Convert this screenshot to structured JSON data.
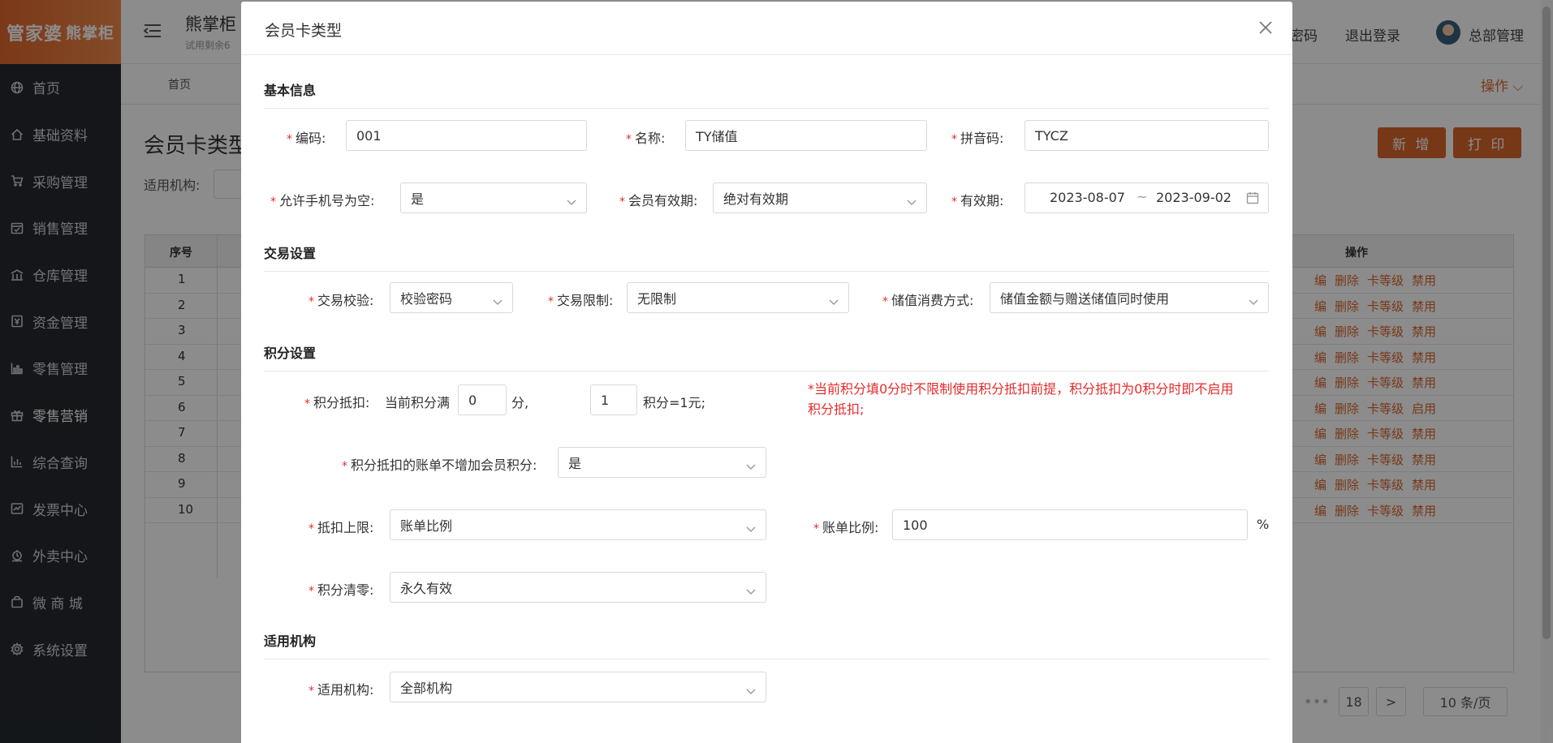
{
  "sidebar": {
    "logo_main": "管家婆",
    "logo_sub": "熊掌柜",
    "items": [
      {
        "label": "首页",
        "icon": "globe-icon"
      },
      {
        "label": "基础资料",
        "icon": "home-icon"
      },
      {
        "label": "采购管理",
        "icon": "cart-icon"
      },
      {
        "label": "销售管理",
        "icon": "calendar-icon"
      },
      {
        "label": "仓库管理",
        "icon": "warehouse-icon"
      },
      {
        "label": "资金管理",
        "icon": "money-icon"
      },
      {
        "label": "零售管理",
        "icon": "chart-icon"
      },
      {
        "label": "零售营销",
        "icon": "gift-icon"
      },
      {
        "label": "综合查询",
        "icon": "bar-chart-icon"
      },
      {
        "label": "发票中心",
        "icon": "invoice-icon"
      },
      {
        "label": "外卖中心",
        "icon": "alarm-icon"
      },
      {
        "label": "微 商 城",
        "icon": "bag-icon"
      },
      {
        "label": "系统设置",
        "icon": "gear-icon"
      }
    ]
  },
  "header": {
    "title": "熊掌柜",
    "subtitle": "试用剩余6",
    "change_password": "密码",
    "logout": "退出登录",
    "user": "总部管理"
  },
  "tabs": {
    "home": "首页",
    "ops": "操作"
  },
  "page": {
    "title": "会员卡类型",
    "filter_label": "适用机构:",
    "add_button": "新 增",
    "print_button": "打 印"
  },
  "table": {
    "col_index": "序号",
    "col_ops": "操作",
    "rows": [
      {
        "idx": "1",
        "ops": [
          "编",
          "删除",
          "卡等级",
          "禁用"
        ]
      },
      {
        "idx": "2",
        "ops": [
          "编",
          "删除",
          "卡等级",
          "禁用"
        ]
      },
      {
        "idx": "3",
        "ops": [
          "编",
          "删除",
          "卡等级",
          "禁用"
        ]
      },
      {
        "idx": "4",
        "ops": [
          "编",
          "删除",
          "卡等级",
          "禁用"
        ]
      },
      {
        "idx": "5",
        "ops": [
          "编",
          "删除",
          "卡等级",
          "禁用"
        ]
      },
      {
        "idx": "6",
        "ops": [
          "编",
          "删除",
          "卡等级",
          "启用"
        ]
      },
      {
        "idx": "7",
        "ops": [
          "编",
          "删除",
          "卡等级",
          "禁用"
        ]
      },
      {
        "idx": "8",
        "ops": [
          "编",
          "删除",
          "卡等级",
          "禁用"
        ]
      },
      {
        "idx": "9",
        "ops": [
          "编",
          "删除",
          "卡等级",
          "禁用"
        ]
      },
      {
        "idx": "10",
        "ops": [
          "编",
          "删除",
          "卡等级",
          "禁用"
        ]
      }
    ]
  },
  "pagination": {
    "last_page": "18",
    "next": ">",
    "page_size": "10 条/页",
    "ellipsis": "•••"
  },
  "modal": {
    "title": "会员卡类型",
    "sections": {
      "basic": "基本信息",
      "trade": "交易设置",
      "points": "积分设置",
      "org": "适用机构"
    },
    "fields": {
      "code_label": "编码:",
      "code_value": "001",
      "name_label": "名称:",
      "name_value": "TY储值",
      "pinyin_label": "拼音码:",
      "pinyin_value": "TYCZ",
      "allow_phone_label": "允许手机号为空:",
      "allow_phone_value": "是",
      "validity_type_label": "会员有效期:",
      "validity_type_value": "绝对有效期",
      "validity_label": "有效期:",
      "validity_start": "2023-08-07",
      "validity_sep": "~",
      "validity_end": "2023-09-02",
      "trade_check_label": "交易校验:",
      "trade_check_value": "校验密码",
      "trade_limit_label": "交易限制:",
      "trade_limit_value": "无限制",
      "stored_mode_label": "储值消费方式:",
      "stored_mode_value": "储值金额与赠送储值同时使用",
      "points_deduct_label": "积分抵扣:",
      "points_pre": "当前积分满",
      "points_min": "0",
      "points_unit": "分,",
      "points_rate": "1",
      "points_rate_suffix": "积分=1元;",
      "points_note": "*当前积分填0分时不限制使用积分抵扣前提，积分抵扣为0积分时即不启用积分抵扣;",
      "no_add_points_label": "积分抵扣的账单不增加会员积分:",
      "no_add_points_value": "是",
      "deduct_limit_label": "抵扣上限:",
      "deduct_limit_value": "账单比例",
      "bill_ratio_label": "账单比例:",
      "bill_ratio_value": "100",
      "bill_ratio_unit": "%",
      "points_clear_label": "积分清零:",
      "points_clear_value": "永久有效",
      "org_label": "适用机构:",
      "org_value": "全部机构"
    }
  },
  "colors": {
    "accent": "#d9662c",
    "required": "#e52b2b",
    "sidebar_bg": "#25292f"
  }
}
